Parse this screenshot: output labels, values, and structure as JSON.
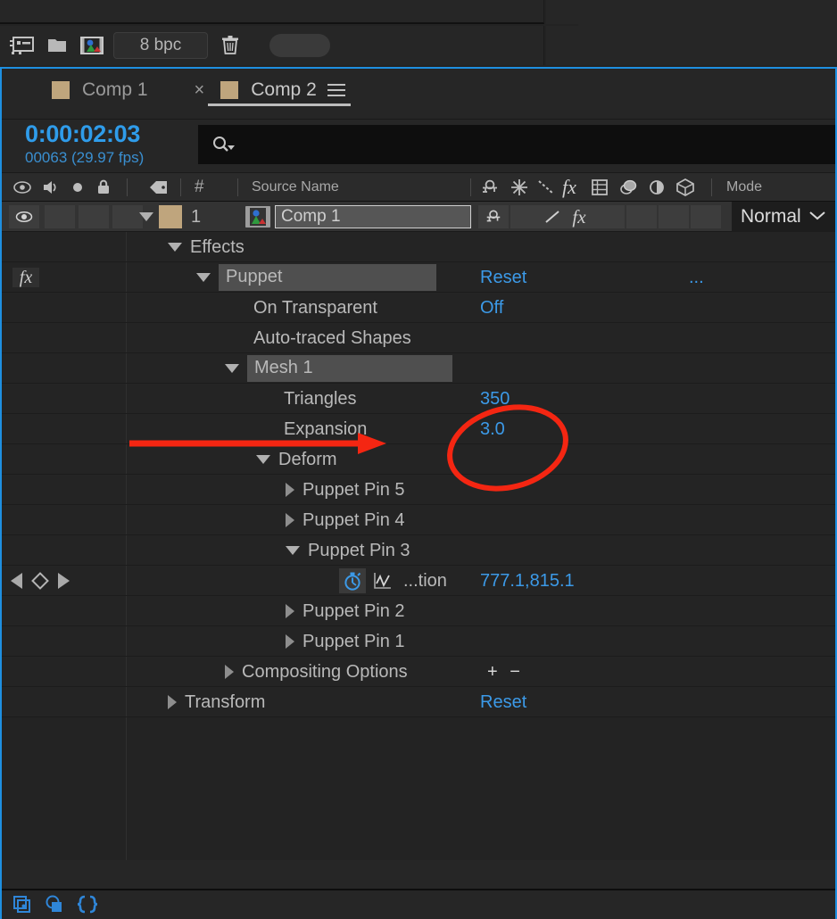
{
  "project_panel": {
    "toolbar": {
      "icons": [
        {
          "name": "project-settings-icon",
          "label": "Project Settings"
        },
        {
          "name": "new-folder-icon",
          "label": "New Folder"
        },
        {
          "name": "new-composition-icon",
          "label": "New Composition"
        }
      ],
      "bit_depth": "8 bpc",
      "delete_icon": "trash-icon"
    }
  },
  "timeline": {
    "tabs": [
      {
        "label": "Comp 1",
        "active": false,
        "closable": false
      },
      {
        "label": "Comp 2",
        "active": true,
        "closable": true
      }
    ],
    "close_glyph": "×",
    "menu_icon": "panel-menu-icon",
    "timecode": "0:00:02:03",
    "frames": "00063 (29.97 fps)",
    "search": {
      "icon": "search-icon",
      "value": "",
      "placeholder": ""
    },
    "columns": {
      "video_icon": "eye-icon",
      "audio_icon": "speaker-icon",
      "solo_icon": "solo-dot-icon",
      "lock_icon": "lock-icon",
      "label_icon": "label-tag-icon",
      "number": "#",
      "source_name": "Source Name",
      "switches": [
        "shy-icon",
        "collapse-transformations-icon",
        "quality-icon",
        "effects-fx-icon",
        "frame-blending-icon",
        "motion-blur-icon",
        "adjustment-layer-icon",
        "3d-layer-icon"
      ],
      "mode": "Mode"
    },
    "layer": {
      "index": "1",
      "source_name": "Comp 1",
      "label_color": "#bfa57d",
      "mode": "Normal",
      "mode_chevron": "chevron-down-icon",
      "source_icon": "composition-thumbnail-icon"
    },
    "rows": [
      {
        "id": "effects",
        "label": "Effects",
        "value": "",
        "indent": 186,
        "twirl": "down",
        "highlight": false,
        "fx": false
      },
      {
        "id": "puppet",
        "label": "Puppet",
        "value": "Reset",
        "indent": 218,
        "twirl": "down",
        "highlight": true,
        "fx": true,
        "extra": "..."
      },
      {
        "id": "on-transparent",
        "label": "On Transparent",
        "value": "Off",
        "indent": 282,
        "twirl": "none",
        "highlight": false,
        "fx": false
      },
      {
        "id": "auto-traced-shapes",
        "label": "Auto-traced Shapes",
        "value": "",
        "indent": 282,
        "twirl": "none",
        "highlight": false,
        "fx": false
      },
      {
        "id": "mesh-1",
        "label": "Mesh 1",
        "value": "",
        "indent": 250,
        "twirl": "down",
        "highlight": true,
        "fx": false
      },
      {
        "id": "triangles",
        "label": "Triangles",
        "value": "350",
        "indent": 316,
        "twirl": "none",
        "highlight": false,
        "fx": false
      },
      {
        "id": "expansion",
        "label": "Expansion",
        "value": "3.0",
        "indent": 316,
        "twirl": "none",
        "highlight": false,
        "fx": false
      },
      {
        "id": "deform",
        "label": "Deform",
        "value": "",
        "indent": 285,
        "twirl": "down",
        "highlight": false,
        "fx": false
      },
      {
        "id": "puppet-pin-5",
        "label": "Puppet Pin 5",
        "value": "",
        "indent": 318,
        "twirl": "right",
        "highlight": false,
        "fx": false
      },
      {
        "id": "puppet-pin-4",
        "label": "Puppet Pin 4",
        "value": "",
        "indent": 318,
        "twirl": "right",
        "highlight": false,
        "fx": false
      },
      {
        "id": "puppet-pin-3",
        "label": "Puppet Pin 3",
        "value": "",
        "indent": 318,
        "twirl": "down",
        "highlight": false,
        "fx": false
      },
      {
        "id": "position",
        "label": "...tion",
        "value": "777.1,815.1",
        "indent": 380,
        "twirl": "none",
        "highlight": false,
        "fx": false,
        "stopwatch": true,
        "graph": true,
        "keyframe_nav": true
      },
      {
        "id": "puppet-pin-2",
        "label": "Puppet Pin 2",
        "value": "",
        "indent": 318,
        "twirl": "right",
        "highlight": false,
        "fx": false
      },
      {
        "id": "puppet-pin-1",
        "label": "Puppet Pin 1",
        "value": "",
        "indent": 318,
        "twirl": "right",
        "highlight": false,
        "fx": false
      },
      {
        "id": "compositing-options",
        "label": "Compositing Options",
        "value": "",
        "indent": 250,
        "twirl": "right",
        "highlight": false,
        "fx": false,
        "plusminus": "+ −"
      },
      {
        "id": "transform",
        "label": "Transform",
        "value": "Reset",
        "indent": 186,
        "twirl": "right",
        "highlight": false,
        "fx": false
      }
    ],
    "bottom_bar": {
      "icons": [
        {
          "name": "layer-switches-toggle-icon"
        },
        {
          "name": "transfer-controls-toggle-icon"
        },
        {
          "name": "in-out-duration-stretch-toggle-icon"
        }
      ]
    }
  },
  "annotations": {
    "arrow": {
      "name": "red-arrow-annotation",
      "points_to": "Expansion"
    },
    "ellipse": {
      "name": "red-ellipse-annotation",
      "encircles": "350 / 3.0"
    }
  },
  "colors": {
    "panel_selection_border": "#1e8fe0",
    "accent_blue": "#3c9ae8",
    "timecode_blue": "#2f9cea",
    "layer_label": "#bfa57d",
    "annotation_red": "#f42612",
    "bg_dark": "#232323",
    "row_bg": "#242424",
    "layer_row_bg": "#333333"
  }
}
